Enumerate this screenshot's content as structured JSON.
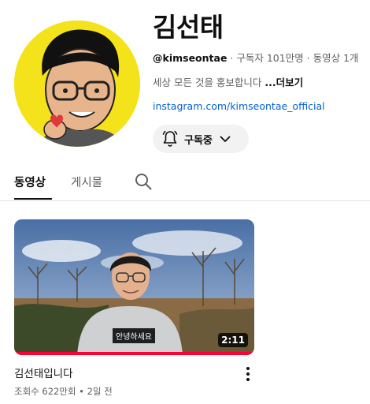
{
  "channel": {
    "name": "김선태",
    "handle": "@kimseontae",
    "stats": " · 구독자 101만명 · 동영상 1개",
    "description": "세상 모든 것을 홍보합니다 ",
    "more_label": "...더보기",
    "link": "instagram.com/kimseontae_official",
    "avatar_bg": "#f4e21a"
  },
  "subscribe": {
    "label": "구독중",
    "icon": "bell-icon",
    "dropdown_icon": "chevron-down-icon"
  },
  "tabs": [
    {
      "label": "동영상",
      "active": true
    },
    {
      "label": "게시물",
      "active": false
    }
  ],
  "search_icon": "search-icon",
  "video": {
    "title": "김선태입니다",
    "meta": "조회수 622만회 • 2일 전",
    "duration": "2:11",
    "caption": "안녕하세요",
    "progress_fraction": 1.0,
    "progress_color": "#ff0033"
  }
}
